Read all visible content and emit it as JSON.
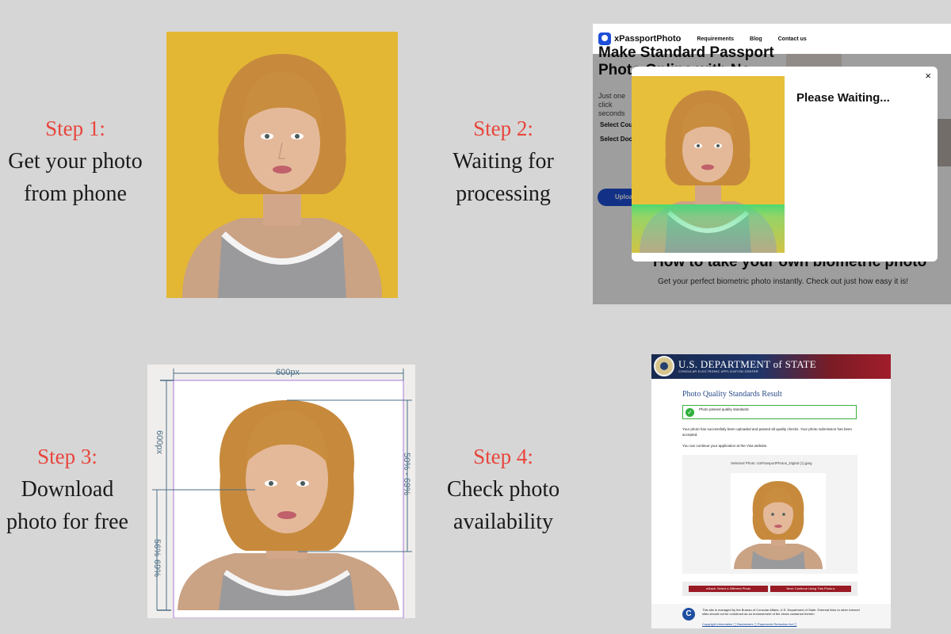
{
  "steps": [
    {
      "title": "Step 1:",
      "lines": [
        "Get your photo",
        "from phone"
      ]
    },
    {
      "title": "Step 2:",
      "lines": [
        "Waiting for",
        "processing"
      ]
    },
    {
      "title": "Step 3:",
      "lines": [
        "Download",
        "photo for free"
      ]
    },
    {
      "title": "Step 4:",
      "lines": [
        "Check photo",
        "availability"
      ]
    }
  ],
  "browser": {
    "brand": "xPassportPhoto",
    "nav": [
      "Requirements",
      "Blog",
      "Contact us"
    ],
    "hero_title": "Make Standard Passport Photo Online with No",
    "hero_sub": "Just one click seconds",
    "select_country": "Select Cou",
    "select_doc": "Select Doc",
    "upload_label": "Uploa",
    "howto_title": "How to take your own biometric photo",
    "howto_sub": "Get your perfect biometric photo instantly. Check out just how easy it is!",
    "modal_title": "Please Waiting...",
    "close_icon": "×"
  },
  "diagram": {
    "width_label": "600px",
    "height_label": "600px",
    "head_ratio_label": "50% - 69%",
    "eye_ratio_label": "56%-69%",
    "line_color": "#4a6d87",
    "frame_color": "#a978d8"
  },
  "dos": {
    "header_title": "U.S. DEPARTMENT of STATE",
    "header_sub": "CONSULAR ELECTRONIC APPLICATION CENTER",
    "page_title": "Photo Quality Standards Result",
    "pass_text": "Photo passed quality standards",
    "para1": "Your photo has successfully been uploaded and passed all quality checks. Your photo submission has been accepted.",
    "para2": "You can continue your application at the Visa website.",
    "selected_photo": "Selected Photo: USPassportPhotos_Digital (1).jpeg",
    "back_button": "◂ Back: Select a Different Photo",
    "next_button": "Next: Continue Using This Photo ▸",
    "footer_text": "This site is managed by the Bureau of Consular Affairs, U.S. Department of State. External links to other Internet sites should not be construed as an endorsement of the views contained therein.",
    "footer_links": "Copyright Information ◻  Disclaimers ◻  Paperwork Reduction Act ◻",
    "footer_logo": "C"
  },
  "colors": {
    "accent_red": "#e8453c",
    "background": "#d6d6d6",
    "photo_yellow": "#e8bf3a"
  }
}
